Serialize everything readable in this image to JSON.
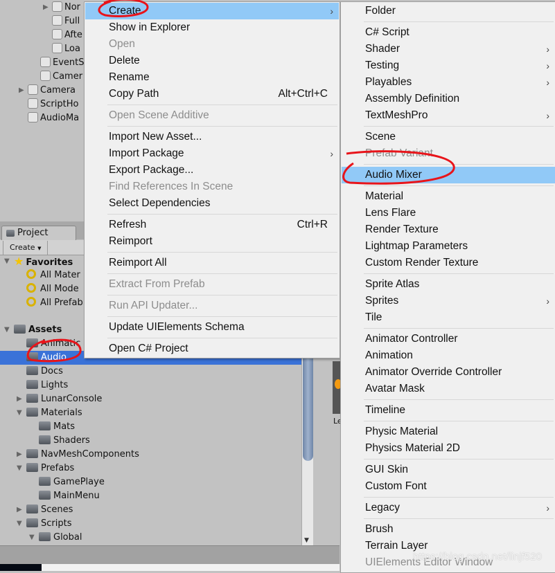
{
  "hierarchy": [
    {
      "label": "Nor",
      "indent": 3,
      "arrow": true
    },
    {
      "label": "Full",
      "indent": 3
    },
    {
      "label": "Afte",
      "indent": 3
    },
    {
      "label": "Loa",
      "indent": 3
    },
    {
      "label": "EventS",
      "indent": 2
    },
    {
      "label": "Camer",
      "indent": 2
    },
    {
      "label": "Camera",
      "indent": 1,
      "arrow": true
    },
    {
      "label": "ScriptHo",
      "indent": 1
    },
    {
      "label": "AudioMa",
      "indent": 1
    }
  ],
  "project": {
    "tab": "Project",
    "create": "Create",
    "favorites": {
      "label": "Favorites",
      "items": [
        "All Mater",
        "All Mode",
        "All Prefab"
      ]
    },
    "assets": {
      "label": "Assets",
      "items": [
        {
          "label": "Animatic",
          "indent": 1
        },
        {
          "label": "Audio",
          "indent": 1,
          "selected": true
        },
        {
          "label": "Docs",
          "indent": 1
        },
        {
          "label": "Lights",
          "indent": 1
        },
        {
          "label": "LunarConsole",
          "indent": 1,
          "arrow": "right"
        },
        {
          "label": "Materials",
          "indent": 1,
          "arrow": "down"
        },
        {
          "label": "Mats",
          "indent": 2
        },
        {
          "label": "Shaders",
          "indent": 2
        },
        {
          "label": "NavMeshComponents",
          "indent": 1,
          "arrow": "right"
        },
        {
          "label": "Prefabs",
          "indent": 1,
          "arrow": "down"
        },
        {
          "label": "GamePlaye",
          "indent": 2
        },
        {
          "label": "MainMenu",
          "indent": 2
        },
        {
          "label": "Scenes",
          "indent": 1,
          "arrow": "right"
        },
        {
          "label": "Scripts",
          "indent": 1,
          "arrow": "down"
        },
        {
          "label": "Global",
          "indent": 2,
          "arrow": "down"
        }
      ]
    },
    "preview_label": "Le"
  },
  "context_menu": [
    {
      "label": "Create",
      "submenu": true,
      "highlighted": true
    },
    {
      "label": "Show in Explorer"
    },
    {
      "label": "Open",
      "disabled": true
    },
    {
      "label": "Delete"
    },
    {
      "label": "Rename"
    },
    {
      "label": "Copy Path",
      "shortcut": "Alt+Ctrl+C"
    },
    {
      "sep": true
    },
    {
      "label": "Open Scene Additive",
      "disabled": true
    },
    {
      "sep": true
    },
    {
      "label": "Import New Asset..."
    },
    {
      "label": "Import Package",
      "submenu": true
    },
    {
      "label": "Export Package..."
    },
    {
      "label": "Find References In Scene",
      "disabled": true
    },
    {
      "label": "Select Dependencies"
    },
    {
      "sep": true
    },
    {
      "label": "Refresh",
      "shortcut": "Ctrl+R"
    },
    {
      "label": "Reimport"
    },
    {
      "sep": true
    },
    {
      "label": "Reimport All"
    },
    {
      "sep": true
    },
    {
      "label": "Extract From Prefab",
      "disabled": true
    },
    {
      "sep": true
    },
    {
      "label": "Run API Updater...",
      "disabled": true
    },
    {
      "sep": true
    },
    {
      "label": "Update UIElements Schema"
    },
    {
      "sep": true
    },
    {
      "label": "Open C# Project"
    }
  ],
  "create_submenu": [
    {
      "label": "Folder"
    },
    {
      "sep": true
    },
    {
      "label": "C# Script"
    },
    {
      "label": "Shader",
      "submenu": true
    },
    {
      "label": "Testing",
      "submenu": true
    },
    {
      "label": "Playables",
      "submenu": true
    },
    {
      "label": "Assembly Definition"
    },
    {
      "label": "TextMeshPro",
      "submenu": true
    },
    {
      "sep": true
    },
    {
      "label": "Scene"
    },
    {
      "label": "Prefab Variant",
      "disabled": true
    },
    {
      "sep": true
    },
    {
      "label": "Audio Mixer",
      "highlighted": true
    },
    {
      "sep": true
    },
    {
      "label": "Material"
    },
    {
      "label": "Lens Flare"
    },
    {
      "label": "Render Texture"
    },
    {
      "label": "Lightmap Parameters"
    },
    {
      "label": "Custom Render Texture"
    },
    {
      "sep": true
    },
    {
      "label": "Sprite Atlas"
    },
    {
      "label": "Sprites",
      "submenu": true
    },
    {
      "label": "Tile"
    },
    {
      "sep": true
    },
    {
      "label": "Animator Controller"
    },
    {
      "label": "Animation"
    },
    {
      "label": "Animator Override Controller"
    },
    {
      "label": "Avatar Mask"
    },
    {
      "sep": true
    },
    {
      "label": "Timeline"
    },
    {
      "sep": true
    },
    {
      "label": "Physic Material"
    },
    {
      "label": "Physics Material 2D"
    },
    {
      "sep": true
    },
    {
      "label": "GUI Skin"
    },
    {
      "label": "Custom Font"
    },
    {
      "sep": true
    },
    {
      "label": "Legacy",
      "submenu": true
    },
    {
      "sep": true
    },
    {
      "label": "Brush"
    },
    {
      "label": "Terrain Layer"
    },
    {
      "label": "UIElements Editor Window",
      "disabled": true
    }
  ],
  "watermark": "https://blog.csdn.net/linjf520",
  "colors": {
    "selection": "#3a72d8",
    "menu_highlight": "#91c9f7",
    "annotation": "#e8141a"
  }
}
